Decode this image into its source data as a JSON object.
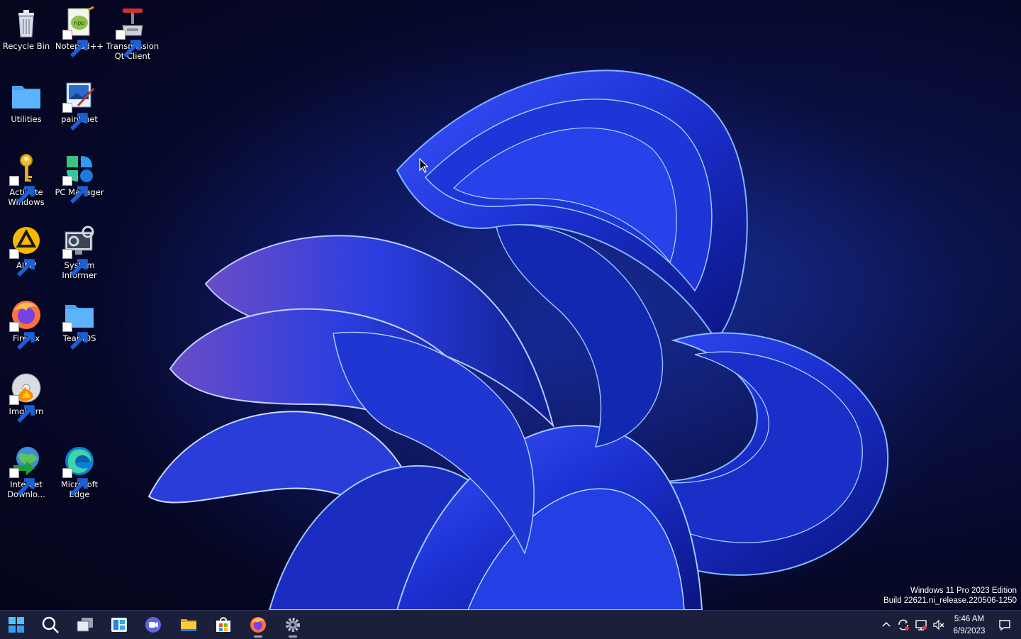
{
  "desktop": {
    "icons": [
      {
        "label": "Recycle Bin"
      },
      {
        "label": "Notepad++"
      },
      {
        "label": "Transmission Qt Client"
      },
      {
        "label": "Utilities"
      },
      {
        "label": "paint.net"
      },
      {
        "label": "Activate Windows"
      },
      {
        "label": "PC Manager"
      },
      {
        "label": "AIMP"
      },
      {
        "label": "System Informer"
      },
      {
        "label": "Firefox"
      },
      {
        "label": "TeamOS"
      },
      {
        "label": "ImgBurn"
      },
      {
        "label": "Internet Downlo..."
      },
      {
        "label": "Microsoft Edge"
      }
    ]
  },
  "watermark": {
    "line1": "Windows 11 Pro 2023 Edition",
    "line2": "Build 22621.ni_release.220506-1250"
  },
  "taskbar": {
    "items": [
      {
        "icon": "windows-start-icon"
      },
      {
        "icon": "search-icon"
      },
      {
        "icon": "task-view-icon"
      },
      {
        "icon": "widgets-icon"
      },
      {
        "icon": "teams-chat-icon"
      },
      {
        "icon": "file-explorer-icon"
      },
      {
        "icon": "microsoft-store-icon"
      },
      {
        "icon": "firefox-icon",
        "active": true
      },
      {
        "icon": "settings-gear-icon",
        "active": true
      }
    ],
    "tray": {
      "icons": [
        "chevron-up-icon",
        "sync-icon",
        "network-icon",
        "volume-muted-icon"
      ],
      "time": "5:46 AM",
      "date": "6/9/2023"
    }
  },
  "colors": {
    "taskbar": "#1b1f3a",
    "accent": "#2f6cff"
  }
}
